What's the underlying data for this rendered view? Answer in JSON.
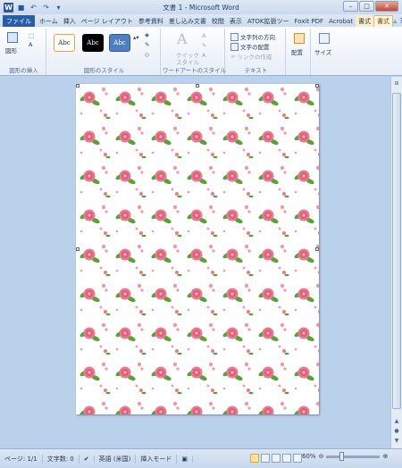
{
  "window": {
    "title": "文書 1 - Microsoft Word",
    "controls": [
      "minimize-icon",
      "maximize-icon",
      "close-icon"
    ]
  },
  "quick_access": [
    "save-icon",
    "undo-icon",
    "redo-icon",
    "customize-icon"
  ],
  "tabs": [
    {
      "label": "ファイル",
      "type": "file"
    },
    {
      "label": "ホーム"
    },
    {
      "label": "挿入"
    },
    {
      "label": "ページ レイアウト"
    },
    {
      "label": "参考資料"
    },
    {
      "label": "差し込み文書"
    },
    {
      "label": "校閲"
    },
    {
      "label": "表示"
    },
    {
      "label": "ATOK拡張ツー"
    },
    {
      "label": "Foxit PDF"
    },
    {
      "label": "Acrobat"
    },
    {
      "label": "書式"
    },
    {
      "label": "書式",
      "active": true
    }
  ],
  "ribbon": {
    "insert_shapes": {
      "label": "図形の挿入",
      "shapes_btn": "図形"
    },
    "shape_styles": {
      "label": "図形のスタイル",
      "sample": [
        "Abc",
        "Abc",
        "Abc"
      ]
    },
    "wordart": {
      "label": "ワードアートのスタイル",
      "quick_style": "クイック",
      "quick_style2": "スタイル",
      "letter": "A"
    },
    "text": {
      "label": "テキスト",
      "direction": "文字列の方向",
      "align": "文字の配置",
      "link": "リンクの作成"
    },
    "arrange": {
      "label": "配置"
    },
    "size": {
      "label": "サイズ"
    }
  },
  "statusbar": {
    "page": "ページ: 1/1",
    "words": "文字数: 0",
    "language": "英語 (米国)",
    "mode": "挿入モード",
    "zoom": "60%",
    "zoom_level": 0.6
  },
  "colors": {
    "accent": "#2b579a",
    "rose": "#e87a8e",
    "leaf": "#5aa03c"
  }
}
